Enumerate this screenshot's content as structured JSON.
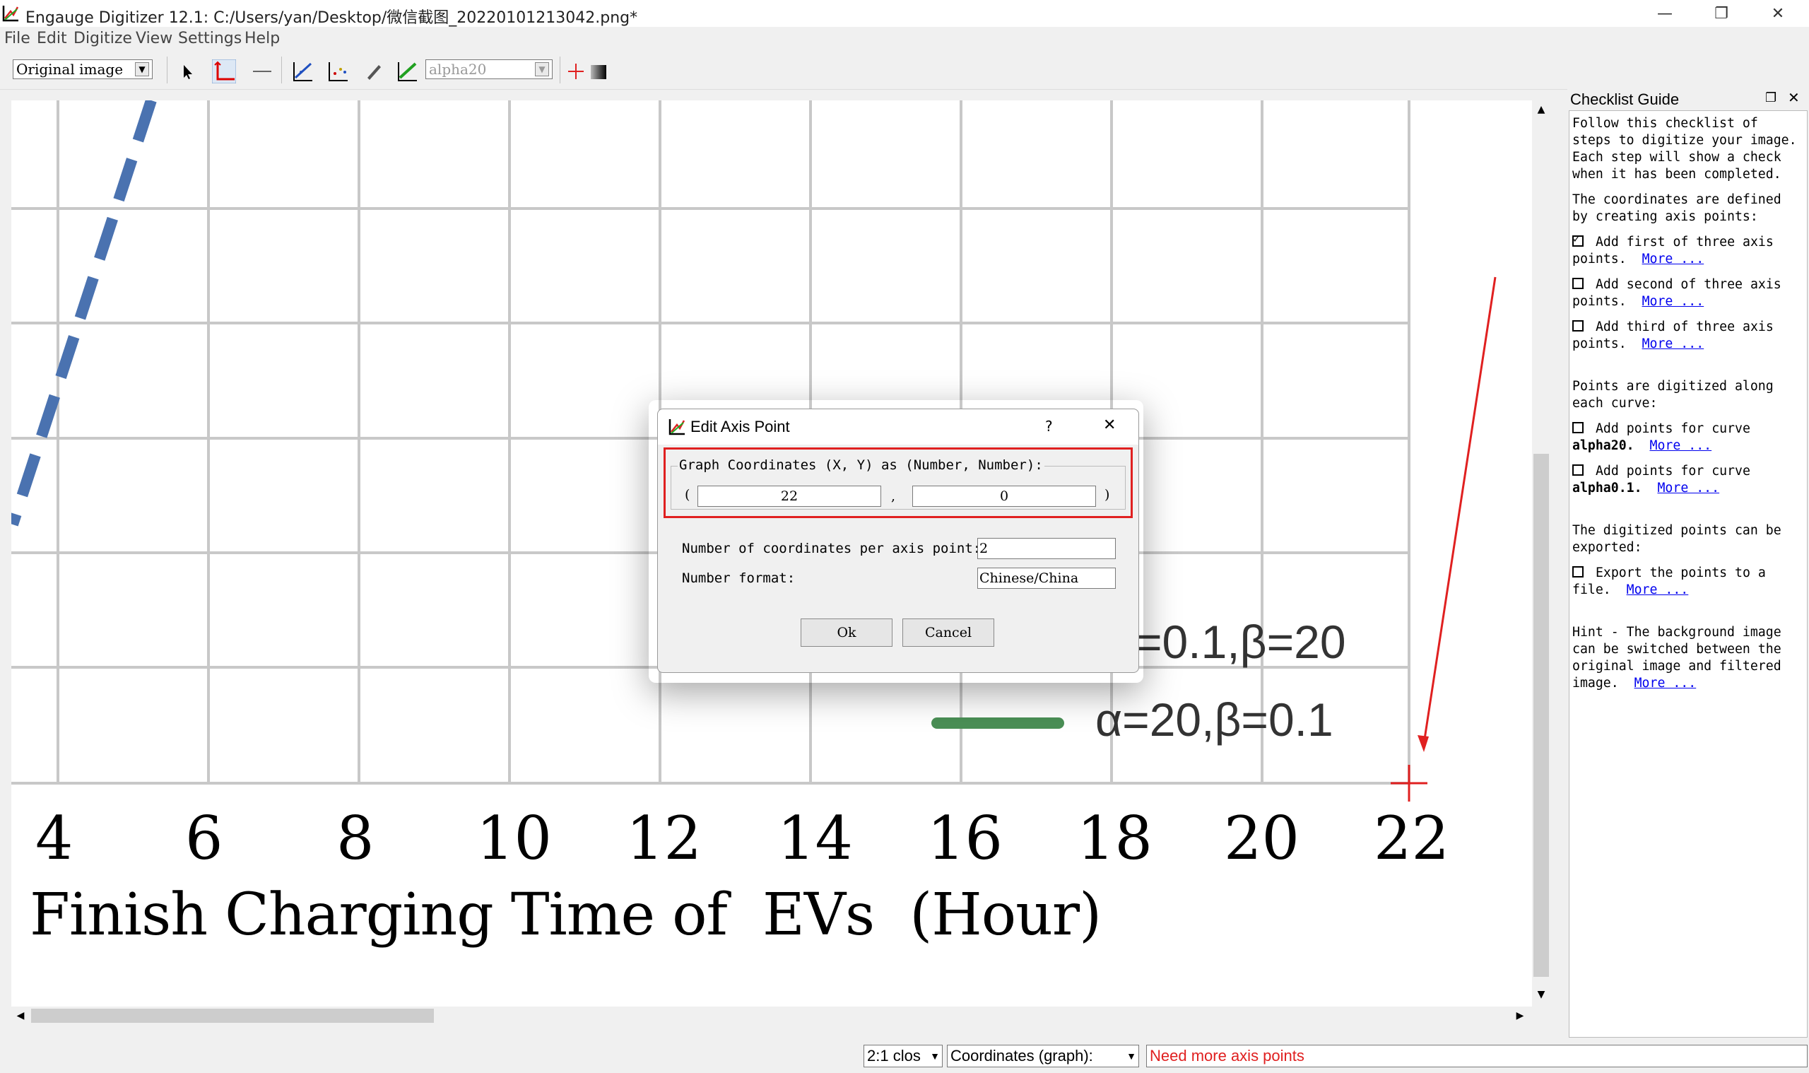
{
  "window": {
    "title": "Engauge Digitizer 12.1: C:/Users/yan/Desktop/微信截图_20220101213042.png*",
    "minimize_glyph": "—",
    "restore_glyph": "❐",
    "close_glyph": "✕"
  },
  "menu": [
    "File",
    "Edit",
    "Digitize",
    "View",
    "Settings",
    "Help"
  ],
  "toolbar": {
    "background_mode": "Original image",
    "curve_select": "alpha20"
  },
  "plot": {
    "x_ticks": [
      "4",
      "6",
      "8",
      "10",
      "12",
      "14",
      "16",
      "18",
      "20",
      "22"
    ],
    "xlabel": "Finish Charging Time of  EVs  (Hour)",
    "legend": [
      {
        "label": "=0.1,β=20",
        "color": "#4a72b0"
      },
      {
        "label": "α=20,β=0.1",
        "color": "#4a8f55"
      }
    ]
  },
  "checklist": {
    "title": "Checklist Guide",
    "intro": [
      "Follow this checklist of",
      "steps to digitize your image.",
      "Each step will show a check",
      "when it has been completed."
    ],
    "axis_intro": [
      "The coordinates are defined",
      "by creating axis points:"
    ],
    "axis_steps": [
      {
        "line1": "Add first of three axis",
        "line2": "points.",
        "link": "More ...",
        "checked": true
      },
      {
        "line1": "Add second of three axis",
        "line2": "points.",
        "link": "More ...",
        "checked": false
      },
      {
        "line1": "Add third of three axis",
        "line2": "points.",
        "link": "More ...",
        "checked": false
      }
    ],
    "curve_intro": [
      "Points are digitized along",
      "each curve:"
    ],
    "curve_steps": [
      {
        "line1": "Add points for curve",
        "line2": "alpha20.",
        "link": "More ..."
      },
      {
        "line1": "Add points for curve",
        "line2": "alpha0.1.",
        "link": "More ..."
      }
    ],
    "export_intro": [
      "The digitized points can be",
      "exported:"
    ],
    "export_step": {
      "line1": "Export the points to a",
      "line2": "file.",
      "link": "More ..."
    },
    "hint": [
      "Hint - The background image",
      "can be switched between the",
      "original image and filtered",
      "image."
    ],
    "hint_link": "More ..."
  },
  "dialog": {
    "title": "Edit Axis Point",
    "help_glyph": "?",
    "close_glyph": "✕",
    "group_label": "Graph Coordinates (X, Y) as (Number, Number):",
    "open_paren": "(",
    "comma": ",",
    "close_paren": ")",
    "x_value": "22",
    "y_value": "0",
    "coords_label": "Number of coordinates per axis point:",
    "coords_value": "2",
    "format_label": "Number format:",
    "format_value": "Chinese/China",
    "ok_label": "Ok",
    "cancel_label": "Cancel"
  },
  "status": {
    "zoom": "2:1 clos",
    "coord_mode": "Coordinates (graph):",
    "message": "Need more axis points"
  },
  "colors": {
    "highlight_red": "#e02020",
    "link_blue": "#0000ee",
    "curve_blue": "#4a72b0",
    "curve_green": "#4a8f55"
  }
}
